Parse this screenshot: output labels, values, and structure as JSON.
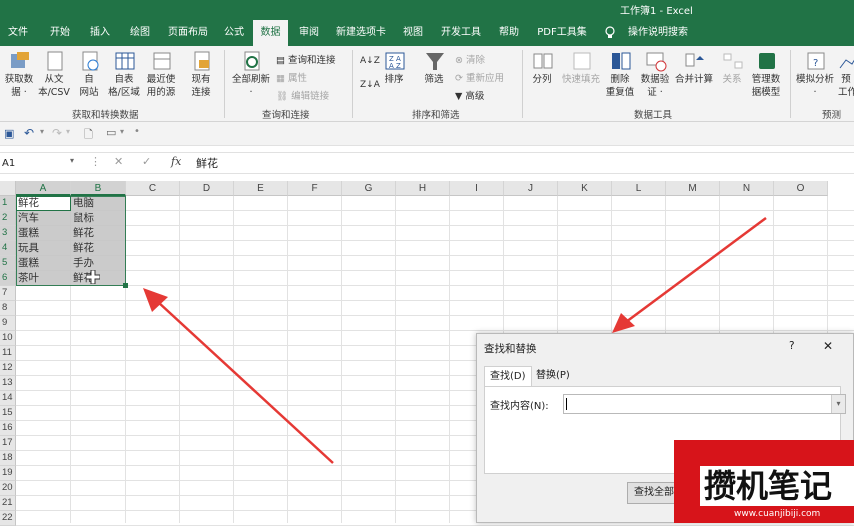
{
  "title": "工作簿1 - Excel",
  "tabs": [
    "文件",
    "开始",
    "插入",
    "绘图",
    "页面布局",
    "公式",
    "数据",
    "审阅",
    "新建选项卡",
    "视图",
    "开发工具",
    "帮助",
    "PDF工具集",
    "操作说明搜索"
  ],
  "ribbon": {
    "get": {
      "btn1": "获取数",
      "btn1b": "据 ·",
      "btn2": "从文",
      "btn2b": "本/CSV",
      "btn3": "自",
      "btn3b": "网站",
      "btn4": "自表",
      "btn4b": "格/区域",
      "btn5": "最近使",
      "btn5b": "用的源",
      "btn6": "现有",
      "btn6b": "连接",
      "label": "获取和转换数据"
    },
    "queries": {
      "refresh": "全部刷新",
      "refresh_b": "·",
      "item1": "查询和连接",
      "item2": "属性",
      "item3": "编辑链接",
      "label": "查询和连接"
    },
    "sort": {
      "sort": "排序",
      "filter": "筛选",
      "clear": "清除",
      "reapply": "重新应用",
      "advanced": "高级",
      "label": "排序和筛选"
    },
    "tools": {
      "split": "分列",
      "flash": "快速填充",
      "remove": "删除",
      "remove_b": "重复值",
      "validate": "数据验",
      "validate_b": "证 ·",
      "consolidate": "合并计算",
      "relation": "关系",
      "model": "管理数",
      "model_b": "据模型",
      "label": "数据工具"
    },
    "forecast": {
      "whatif": "模拟分析",
      "whatif_b": "·",
      "sheet": "预",
      "sheet_b": "工作",
      "label": "预测"
    }
  },
  "formula_bar": {
    "name_box": "A1",
    "fx": "fx",
    "content": "鲜花"
  },
  "columns": [
    "A",
    "B",
    "C",
    "D",
    "E",
    "F",
    "G",
    "H",
    "I",
    "J",
    "K",
    "L",
    "M",
    "N",
    "O"
  ],
  "rows": [
    "1",
    "2",
    "3",
    "4",
    "5",
    "6",
    "7",
    "8",
    "9",
    "10",
    "11",
    "12",
    "13",
    "14",
    "15",
    "16",
    "17",
    "18",
    "19",
    "20",
    "21",
    "22"
  ],
  "cells": [
    [
      "鲜花",
      "电脑"
    ],
    [
      "汽车",
      "鼠标"
    ],
    [
      "蛋糕",
      "鲜花"
    ],
    [
      "玩具",
      "鲜花"
    ],
    [
      "蛋糕",
      "手办"
    ],
    [
      "茶叶",
      "鲜花"
    ]
  ],
  "dialog": {
    "title": "查找和替换",
    "help": "?",
    "close": "✕",
    "tab_find": "查找(D)",
    "tab_replace": "替换(P)",
    "find_label": "查找内容(N):",
    "find_value": "",
    "find_all": "查找全部"
  },
  "watermark": {
    "text": "攒机笔记",
    "url": "www.cuanjibiji.com"
  },
  "colors": {
    "excel_green": "#217346",
    "arrow_red": "#e53935",
    "watermark_red": "#d7141a"
  }
}
